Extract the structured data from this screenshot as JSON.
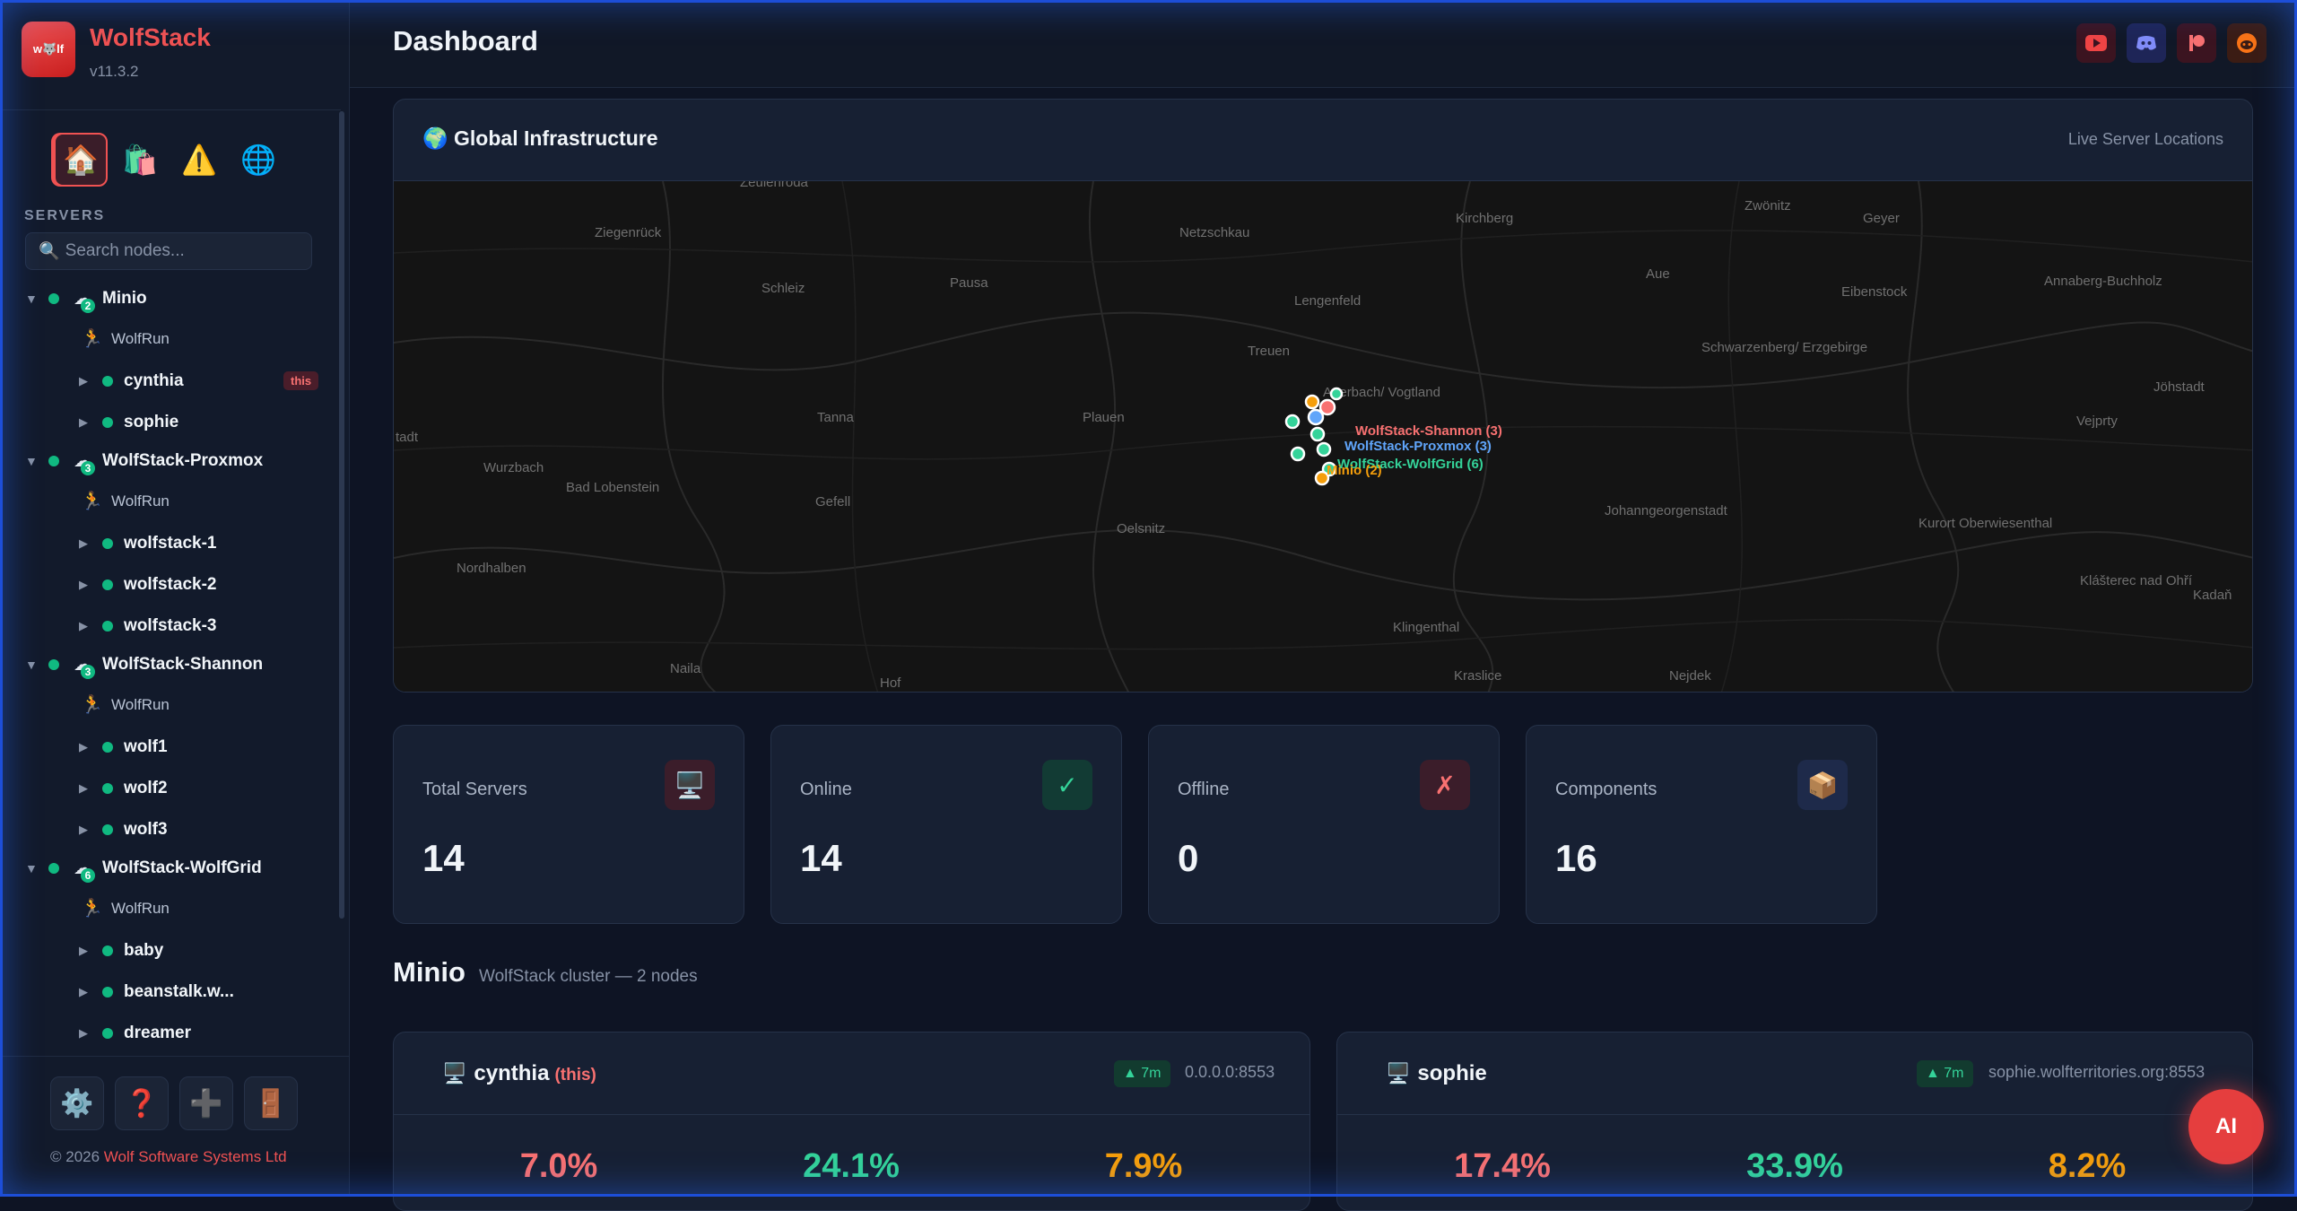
{
  "app": {
    "name": "WolfStack",
    "version": "v11.3.2",
    "logo_text": "w🐺lf"
  },
  "sidebar": {
    "quick_nav": [
      {
        "icon": "home-icon",
        "glyph": "🏠"
      },
      {
        "icon": "shopping-bag-icon",
        "glyph": "🛍️"
      },
      {
        "icon": "warning-icon",
        "glyph": "⚠️"
      },
      {
        "icon": "globe-icon",
        "glyph": "🌐"
      }
    ],
    "section_label": "SERVERS",
    "search_placeholder": "Search nodes...",
    "clusters": [
      {
        "name": "Minio",
        "count": "2",
        "run": "WolfRun",
        "nodes": [
          {
            "name": "cynthia",
            "badge": "this"
          },
          {
            "name": "sophie"
          }
        ]
      },
      {
        "name": "WolfStack-Proxmox",
        "count": "3",
        "run": "WolfRun",
        "nodes": [
          {
            "name": "wolfstack-1"
          },
          {
            "name": "wolfstack-2"
          },
          {
            "name": "wolfstack-3"
          }
        ]
      },
      {
        "name": "WolfStack-Shannon",
        "count": "3",
        "run": "WolfRun",
        "nodes": [
          {
            "name": "wolf1"
          },
          {
            "name": "wolf2"
          },
          {
            "name": "wolf3"
          }
        ]
      },
      {
        "name": "WolfStack-WolfGrid",
        "count": "6",
        "run": "WolfRun",
        "nodes": [
          {
            "name": "baby"
          },
          {
            "name": "beanstalk.w..."
          },
          {
            "name": "dreamer"
          }
        ]
      }
    ],
    "footer_icons": [
      {
        "icon": "gear-icon",
        "glyph": "⚙️"
      },
      {
        "icon": "help-icon",
        "glyph": "❓"
      },
      {
        "icon": "add-icon",
        "glyph": "➕"
      },
      {
        "icon": "logout-door-icon",
        "glyph": "🚪"
      }
    ],
    "copyright_prefix": "© 2026 ",
    "copyright_company": "Wolf Software Systems Ltd"
  },
  "header": {
    "title": "Dashboard",
    "social": [
      {
        "icon": "youtube-icon",
        "bg": "#3b1420",
        "color": "#ef4444"
      },
      {
        "icon": "discord-icon",
        "bg": "#1e2557",
        "color": "#818cf8"
      },
      {
        "icon": "patreon-icon",
        "bg": "#3b1420",
        "color": "#f87171"
      },
      {
        "icon": "reddit-icon",
        "bg": "#3b1c14",
        "color": "#f97316"
      }
    ]
  },
  "map": {
    "title": "🌍 Global Infrastructure",
    "subtitle": "Live Server Locations",
    "places": [
      "Zeulenroda",
      "Ziegenrück",
      "Netzschkau",
      "Kirchberg",
      "Zwönitz",
      "Geyer",
      "Schleiz",
      "Pausa",
      "Lengenfeld",
      "Aue",
      "Eibenstock",
      "Treuen",
      "Schwarzenberg/ Erzgebirge",
      "Annaberg-Buchholz",
      "Tanna",
      "Plauen",
      "Auerbach/ Vogtland",
      "Jöhstadt",
      "Vejprty",
      "Wurzbach",
      "Bad Lobenstein",
      "Gefell",
      "Oelsnitz",
      "Johanngeorgenstadt",
      "Kurort Oberwiesenthal",
      "Nordhalben",
      "Klingenthal",
      "Klášterec nad Ohří",
      "Kadaň",
      "Naila",
      "Hof",
      "Kraslice",
      "Nejdek",
      "tadt"
    ],
    "markers": [
      "WolfStack-Shannon (3)",
      "WolfStack-Proxmox (3)",
      "WolfStack-WolfGrid (6)",
      "Minio (2)"
    ],
    "colors": {
      "shannon": "#f87171",
      "proxmox": "#60a5fa",
      "wolfgrid": "#34d399",
      "minio": "#f59e0b"
    }
  },
  "stats": [
    {
      "label": "Total Servers",
      "value": "14",
      "icon": "server-monitor-icon",
      "glyph": "🖥️",
      "bg": "#3b1d2a"
    },
    {
      "label": "Online",
      "value": "14",
      "icon": "check-icon",
      "glyph": "✓",
      "bg": "#123b34",
      "color": "#34d399"
    },
    {
      "label": "Offline",
      "value": "0",
      "icon": "cross-icon",
      "glyph": "✗",
      "bg": "#3b1d2a",
      "color": "#f87171"
    },
    {
      "label": "Components",
      "value": "16",
      "icon": "package-icon",
      "glyph": "📦",
      "bg": "#1e2a4a"
    }
  ],
  "cluster_section": {
    "title": "Minio",
    "subtitle": "WolfStack cluster — 2 nodes"
  },
  "servers": [
    {
      "name": "cynthia",
      "tag": "(this)",
      "uptime": "▲ 7m",
      "address": "0.0.0.0:8553",
      "metrics": [
        "7.0%",
        "24.1%",
        "7.9%"
      ]
    },
    {
      "name": "sophie",
      "tag": "",
      "uptime": "▲ 7m",
      "address": "sophie.wolfterritories.org:8553",
      "metrics": [
        "17.4%",
        "33.9%",
        "8.2%"
      ]
    }
  ],
  "ai_button": "AI"
}
